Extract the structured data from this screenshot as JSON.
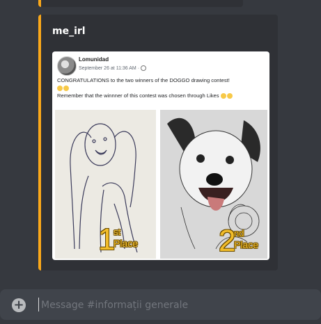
{
  "embed": {
    "accent_color": "#faa81a",
    "title": "me_irl",
    "post": {
      "author": "Lomunidad",
      "date": "September 26 at 11:36 AM ·",
      "line1": "CONGRATULATIONS to the two winners of the DOGGO drawing contest!",
      "line3": "Remember that the winnner of this contest was chosen through Likes",
      "left_image": {
        "place_num": "1",
        "place_suffix": "st",
        "place_word": "Place"
      },
      "right_image": {
        "place_num": "2",
        "place_suffix": "nd",
        "place_word": "Place"
      }
    }
  },
  "composer": {
    "placeholder": "Message #informații generale",
    "plus_icon": "plus-circle-icon"
  }
}
